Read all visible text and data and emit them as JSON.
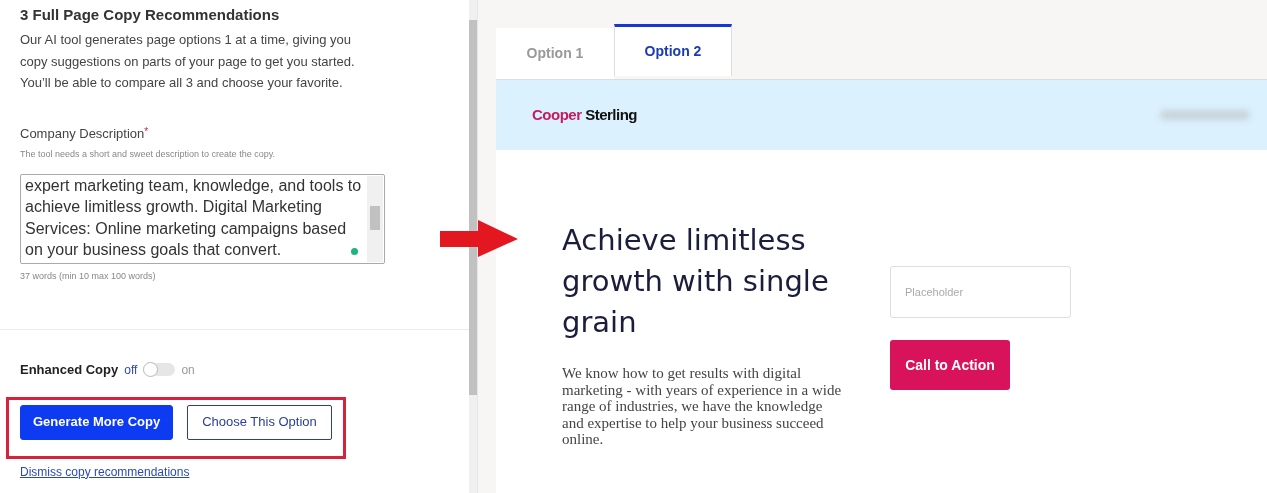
{
  "panel": {
    "title": "3 Full Page Copy Recommendations",
    "intro": "Our AI tool generates page options 1 at a time, giving you copy suggestions on parts of your page to get you started. You’ll be able to compare all 3 and choose your favorite.",
    "description": {
      "label": "Company Description",
      "required_mark": "*",
      "hint": "The tool needs a short and sweet description to create the copy.",
      "value": "expert marketing team, knowledge, and tools to achieve limitless growth. Digital Marketing Services: Online marketing campaigns based on your business goals that convert.",
      "count": "37 words (min 10 max 100 words)"
    },
    "enhanced_copy": {
      "label": "Enhanced Copy",
      "off_label": "off",
      "on_label": "on",
      "on": false
    },
    "buttons": [
      {
        "label": "Generate More Copy",
        "kind": "primary"
      },
      {
        "label": "Choose This Option",
        "kind": "outline"
      }
    ],
    "dismiss_link": "Dismiss copy recommendations"
  },
  "preview": {
    "tabs": [
      {
        "label": "Option 1",
        "selected": false
      },
      {
        "label": "Option 2",
        "selected": true
      }
    ],
    "brand": {
      "first": "Cooper",
      "second": "Sterling"
    },
    "headline": "Achieve limitless growth with single grain",
    "body": "We know how to get results with digital marketing - with years of experience in a wide range of industries, we have the knowledge and expertise to help your business succeed online.",
    "input_placeholder": "Placeholder",
    "cta": "Call to Action"
  }
}
